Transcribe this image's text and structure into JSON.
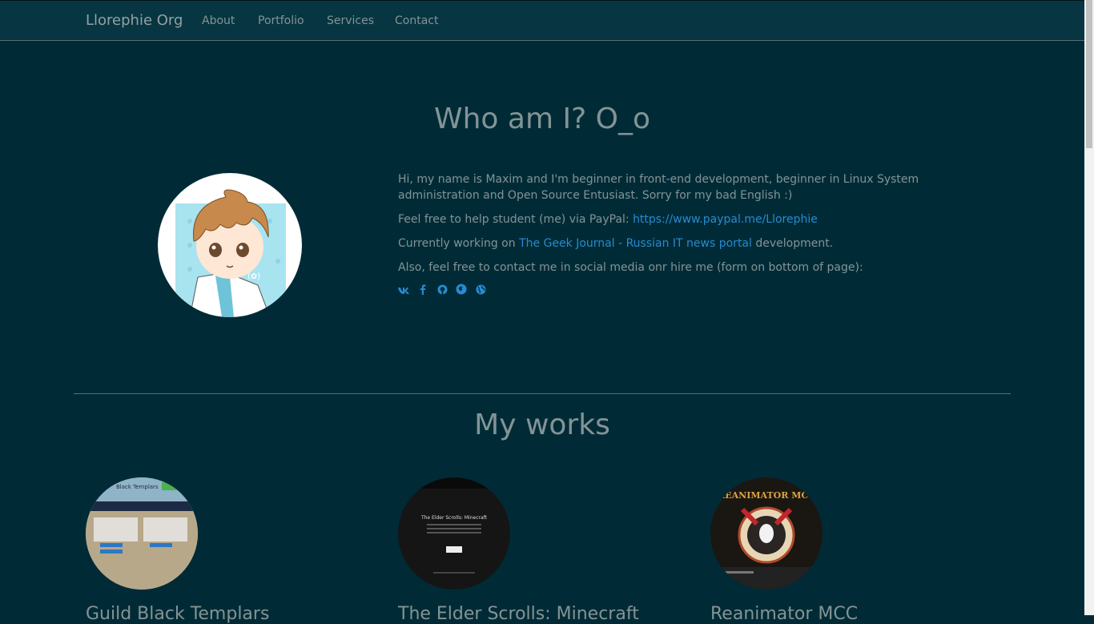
{
  "nav": {
    "brand": "Llorephie Org",
    "links": [
      "About",
      "Portfolio",
      "Services",
      "Contact"
    ]
  },
  "about": {
    "title": "Who am I? O_o",
    "p1": "Hi, my name is Maxim and I'm beginner in front-end development, beginner in Linux System administration and Open Source Entusiast. Sorry for my bad English :)",
    "p2_prefix": "Feel free to help student (me) via PayPal: ",
    "p2_link": "https://www.paypal.me/Llorephie",
    "p3_prefix": "Currently working on ",
    "p3_link": "The Geek Journal - Russian IT news portal",
    "p3_suffix": " development.",
    "p4": "Also, feel free to contact me in social media onr hire me (form on bottom of page):",
    "social_icons": [
      "vk-icon",
      "facebook-icon",
      "github-icon",
      "firefox-icon",
      "globe-icon"
    ]
  },
  "works": {
    "title": "My works",
    "items": [
      {
        "title": "Guild Black Templars",
        "thumb_text": "Black Templars"
      },
      {
        "title": "The Elder Scrolls: Minecraft",
        "thumb_text": "The Elder Scrolls: Minecraft"
      },
      {
        "title": "Reanimator MCC",
        "thumb_text": "REANIMATOR MCC"
      }
    ]
  },
  "colors": {
    "background": "#002b36",
    "navbar": "#073642",
    "link": "#268bd2",
    "text": "#839496"
  }
}
